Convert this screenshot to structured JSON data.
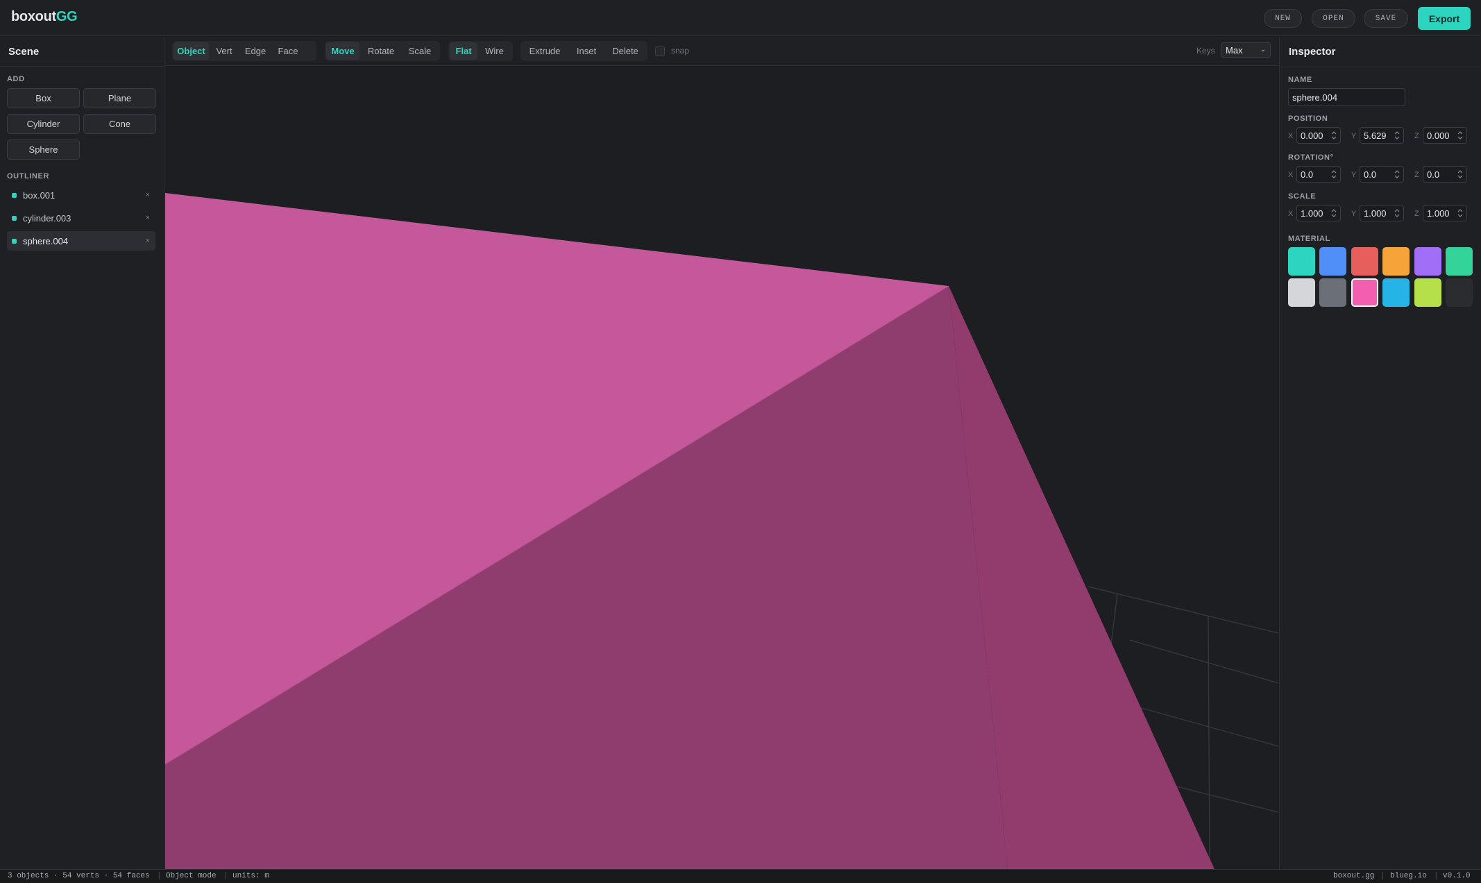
{
  "app": {
    "logo_main": "boxout",
    "logo_accent": "GG"
  },
  "header": {
    "new_label": "NEW",
    "open_label": "OPEN",
    "save_label": "SAVE",
    "export_label": "Export"
  },
  "scene": {
    "title": "Scene",
    "add_label": "ADD",
    "add_buttons": [
      "Box",
      "Plane",
      "Cylinder",
      "Cone",
      "Sphere"
    ],
    "outliner_label": "OUTLINER",
    "objects": [
      {
        "name": "box.001",
        "selected": false
      },
      {
        "name": "cylinder.003",
        "selected": false
      },
      {
        "name": "sphere.004",
        "selected": true
      }
    ],
    "remove_glyph": "×"
  },
  "toolbar": {
    "select_modes": [
      "Object",
      "Vert",
      "Edge",
      "Face"
    ],
    "transform_modes": [
      "Move",
      "Rotate",
      "Scale"
    ],
    "shading_modes": [
      "Flat",
      "Wire"
    ],
    "ops": [
      "Extrude",
      "Inset",
      "Delete"
    ],
    "active_select": "Object",
    "active_transform": "Move",
    "active_shading": "Flat",
    "snap_label": "snap",
    "snap_checked": false,
    "keys_label": "Keys",
    "keys_value": "Max"
  },
  "inspector": {
    "title": "Inspector",
    "name_label": "NAME",
    "name_value": "sphere.004",
    "position_label": "POSITION",
    "position": {
      "x": "0.000",
      "y": "5.629",
      "z": "0.000"
    },
    "rotation_label": "ROTATION°",
    "rotation": {
      "x": "0.0",
      "y": "0.0",
      "z": "0.0"
    },
    "scale_label": "SCALE",
    "scale": {
      "x": "1.000",
      "y": "1.000",
      "z": "1.000"
    },
    "axis_x": "X",
    "axis_y": "Y",
    "axis_z": "Z",
    "material_label": "MATERIAL",
    "materials": [
      "#2dd4bf",
      "#4f8ff7",
      "#e65f5c",
      "#f5a43a",
      "#a16ef7",
      "#34d399",
      "#d4d6da",
      "#6b7078",
      "#f25fb0",
      "#26b3e6",
      "#b5e04a",
      "#2a2c30"
    ],
    "selected_material": "#f25fb0"
  },
  "status": {
    "stats": "3 objects · 54 verts · 54 faces",
    "mode": "Object mode",
    "units": "units: m",
    "site": "boxout.gg",
    "domain": "blueg.io",
    "version": "v0.1.0",
    "separator": "|"
  },
  "colors": {
    "accent": "#2dd4bf",
    "mesh_light": "#c5579b",
    "mesh_dark": "#8f3c6f",
    "mesh_right": "#923c6e"
  }
}
